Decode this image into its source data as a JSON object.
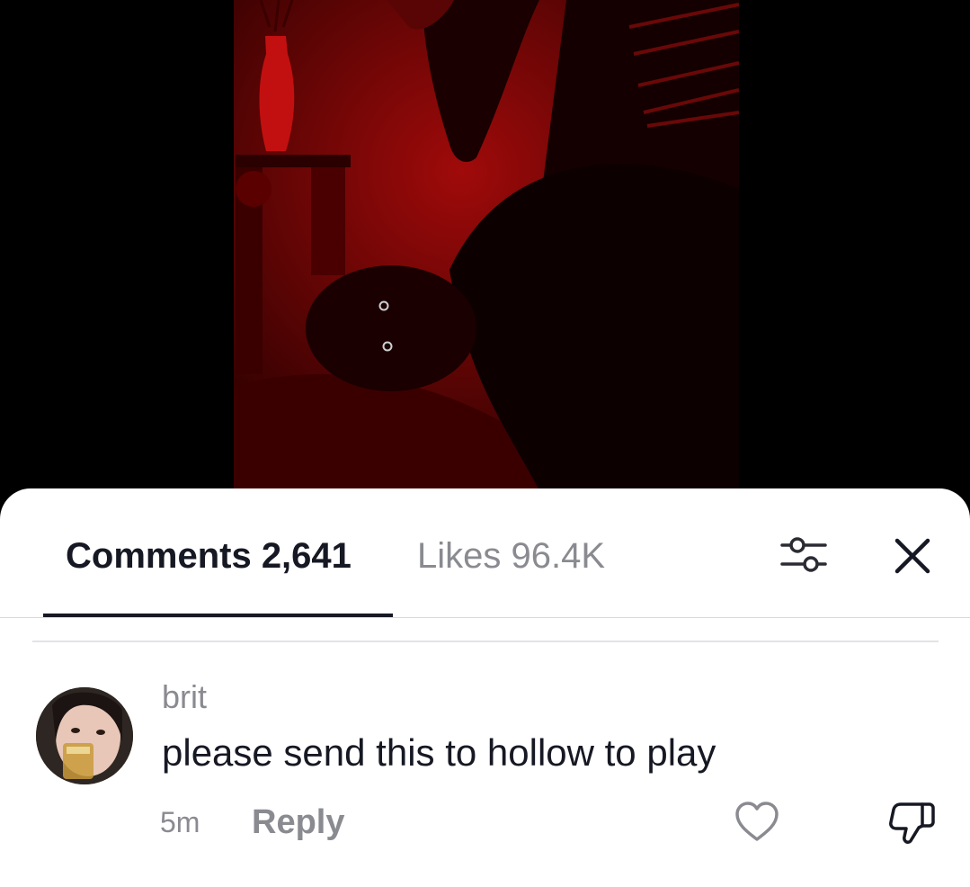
{
  "video": {
    "description_icon": "video-frame"
  },
  "tabs": {
    "comments_label": "Comments 2,641",
    "likes_label": "Likes 96.4K"
  },
  "icons": {
    "filter": "sliders-icon",
    "close": "close-icon",
    "like": "heart-icon",
    "dislike": "thumbs-down-icon"
  },
  "comment": {
    "username": "brit",
    "text": "please send this to hollow to play",
    "timestamp": "5m",
    "reply_label": "Reply"
  },
  "colors": {
    "primary_text": "#161823",
    "secondary_text": "#8a8b91",
    "video_red": "#8a0000"
  }
}
